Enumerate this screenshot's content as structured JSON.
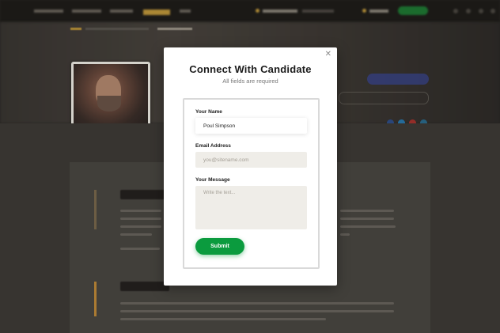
{
  "modal": {
    "close_icon": "close-icon",
    "title": "Connect With Candidate",
    "subtitle": "All fields are required",
    "fields": {
      "name": {
        "label": "Your Name",
        "value": "Poul Simpson"
      },
      "email": {
        "label": "Email Address",
        "placeholder": "you@sitename.com"
      },
      "message": {
        "label": "Your Message",
        "placeholder": "Write the text..."
      }
    },
    "submit_label": "Submit",
    "colors": {
      "submit": "#0b9b3e",
      "title": "#1b1b1b"
    }
  },
  "background": {
    "note_obscured": "",
    "colors": {
      "accent": "#c39a3c",
      "hero_button": "#3d4fb8",
      "post_button": "#1f7a34"
    }
  }
}
